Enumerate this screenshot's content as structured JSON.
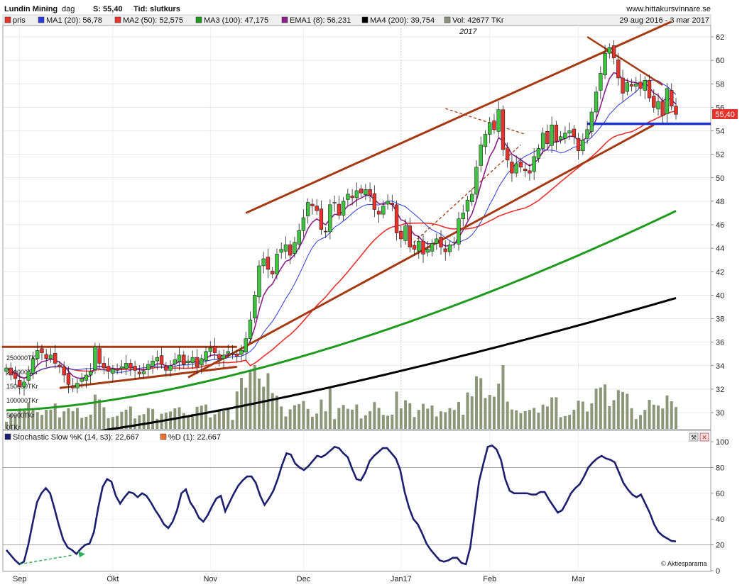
{
  "header": {
    "stock": "Lundin Mining",
    "period": "dag",
    "price_label": "S: 55,40",
    "type_label": "Tid: slutkurs",
    "site": "www.hittakursvinnare.se",
    "date_range": "29 aug 2016 - 3 mar 2017"
  },
  "legend": [
    {
      "label": "pris",
      "color": "#e8322c"
    },
    {
      "label": "MA1 (20): 56,78",
      "color": "#2a3bd6"
    },
    {
      "label": "MA2 (50): 52,575",
      "color": "#e8322c"
    },
    {
      "label": "MA3 (100): 47,175",
      "color": "#1f9a1f"
    },
    {
      "label": "EMA1 (8): 56,231",
      "color": "#8a1f8a"
    },
    {
      "label": "MA4 (200): 39,754",
      "color": "#000000"
    },
    {
      "label": "Vol: 42677 TKr",
      "color": "#8a9178"
    }
  ],
  "year_marker": "2017",
  "price_tag": "55,40",
  "osc_legend": [
    {
      "label": "Stochastic Slow %K (14, s3): 22,667",
      "color": "#1b1f6e"
    },
    {
      "label": "%D (1): 22,667",
      "color": "#e8732c"
    }
  ],
  "volume_labels": [
    "250000TKr",
    "200000TKr",
    "150000TKr",
    "100000TKr",
    "50000TKr",
    "0TKr"
  ],
  "watermark": "Aktiespararna",
  "chart_data": [
    {
      "type": "candlestick",
      "title": "Lundin Mining",
      "ylim": [
        28.5,
        63.5
      ],
      "y_ticks": [
        30,
        32,
        34,
        36,
        38,
        40,
        42,
        44,
        46,
        48,
        50,
        52,
        54,
        56,
        58,
        60,
        62
      ],
      "x_ticks": [
        "Sep",
        "Okt",
        "Nov",
        "Dec",
        "Jan17",
        "Feb",
        "Mar"
      ],
      "grid": true,
      "last_price": 55.4,
      "closes": [
        33.8,
        33.2,
        32.9,
        32.2,
        32.6,
        33.5,
        34.6,
        35.3,
        35.1,
        34.6,
        34.9,
        34.2,
        33.9,
        33.2,
        32.4,
        32.1,
        32.5,
        32.9,
        33.2,
        33.5,
        35.6,
        34.2,
        33.8,
        33.5,
        33.7,
        33.6,
        33.9,
        34.2,
        33.8,
        33.6,
        33.3,
        33.5,
        34.1,
        34.4,
        34.7,
        34.1,
        33.6,
        34.0,
        34.5,
        34.9,
        34.1,
        34.4,
        34.7,
        33.9,
        34.6,
        35.2,
        35.5,
        35.1,
        34.6,
        34.9,
        35.2,
        35.0,
        34.8,
        35.3,
        36.3,
        37.9,
        40.0,
        42.5,
        43.1,
        42.2,
        41.8,
        43.5,
        43.9,
        44.3,
        43.4,
        44.5,
        45.5,
        46.6,
        47.9,
        47.6,
        47.2,
        45.6,
        45.4,
        47.7,
        47.9,
        46.8,
        48.0,
        48.6,
        48.3,
        48.9,
        48.7,
        49.0,
        48.5,
        47.3,
        46.9,
        47.6,
        48.0,
        47.7,
        45.3,
        44.8,
        45.9,
        44.1,
        43.9,
        44.6,
        43.5,
        43.9,
        44.4,
        44.8,
        44.1,
        43.7,
        44.3,
        44.5,
        46.5,
        47.0,
        48.1,
        48.6,
        50.9,
        52.8,
        53.7,
        54.7,
        54.1,
        55.8,
        52.4,
        51.5,
        50.4,
        51.2,
        50.9,
        50.6,
        50.4,
        51.8,
        52.5,
        53.8,
        52.9,
        54.5,
        53.1,
        53.5,
        53.8,
        54.0,
        53.5,
        52.3,
        53.2,
        54.1,
        55.6,
        57.3,
        58.9,
        60.6,
        61.1,
        60.2,
        58.5,
        57.2,
        58.1,
        57.8,
        58.0,
        57.6,
        58.3,
        56.8,
        56.0,
        56.5,
        55.3,
        57.6,
        56.1,
        55.4
      ],
      "series": [
        {
          "name": "MA1 (20)",
          "last": 56.78
        },
        {
          "name": "MA2 (50)",
          "last": 52.575
        },
        {
          "name": "MA3 (100)",
          "last": 47.175
        },
        {
          "name": "EMA1 (8)",
          "last": 56.231
        },
        {
          "name": "MA4 (200)",
          "last": 39.754
        },
        {
          "name": "Vol",
          "last": 42677,
          "unit": "TKr"
        }
      ]
    },
    {
      "type": "line",
      "title": "Stochastic Slow %K (14, s3)",
      "ylim": [
        0,
        100
      ],
      "y_ticks": [
        0,
        20,
        40,
        60,
        80,
        100
      ],
      "reference_lines": [
        20,
        80
      ],
      "values": [
        16,
        12,
        8,
        5,
        7,
        20,
        37,
        53,
        60,
        64,
        60,
        48,
        35,
        24,
        18,
        16,
        13,
        17,
        20,
        21,
        30,
        49,
        65,
        71,
        69,
        58,
        52,
        57,
        61,
        60,
        57,
        60,
        58,
        53,
        47,
        42,
        36,
        33,
        38,
        47,
        60,
        63,
        53,
        48,
        41,
        38,
        43,
        50,
        56,
        58,
        46,
        53,
        60,
        66,
        70,
        73,
        73,
        68,
        58,
        51,
        56,
        62,
        71,
        82,
        91,
        90,
        83,
        80,
        78,
        81,
        85,
        89,
        88,
        90,
        93,
        96,
        95,
        91,
        88,
        79,
        71,
        70,
        76,
        85,
        89,
        92,
        95,
        95,
        91,
        87,
        78,
        61,
        49,
        40,
        36,
        29,
        21,
        16,
        12,
        8,
        7,
        8,
        10,
        10,
        6,
        5,
        18,
        44,
        69,
        83,
        96,
        97,
        94,
        86,
        71,
        62,
        60,
        60,
        60,
        60,
        59,
        59,
        61,
        61,
        55,
        50,
        45,
        47,
        53,
        60,
        64,
        67,
        73,
        80,
        84,
        87,
        89,
        87,
        86,
        84,
        76,
        68,
        63,
        59,
        57,
        59,
        52,
        45,
        36,
        30,
        27,
        25,
        23,
        22.667
      ]
    }
  ]
}
